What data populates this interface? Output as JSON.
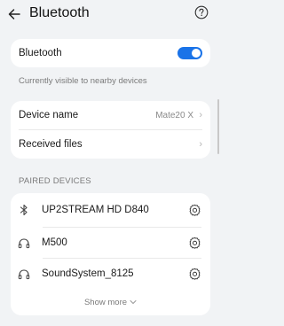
{
  "header": {
    "title": "Bluetooth",
    "back_icon": "arrow-left-icon",
    "help_icon": "question-circle-icon"
  },
  "bluetooth_card": {
    "label": "Bluetooth",
    "toggle_on": true,
    "accent_color": "#1a73e8"
  },
  "visibility_caption": "Currently visible to nearby devices",
  "info_card": {
    "device_name_label": "Device name",
    "device_name_value": "Mate20 X",
    "received_files_label": "Received files"
  },
  "paired_section_title": "PAIRED DEVICES",
  "paired_devices": [
    {
      "name": "UP2STREAM HD D840",
      "icon": "bluetooth-icon"
    },
    {
      "name": "M500",
      "icon": "headphones-icon"
    },
    {
      "name": "SoundSystem_8125",
      "icon": "headphones-icon"
    }
  ],
  "show_more_label": "Show more"
}
